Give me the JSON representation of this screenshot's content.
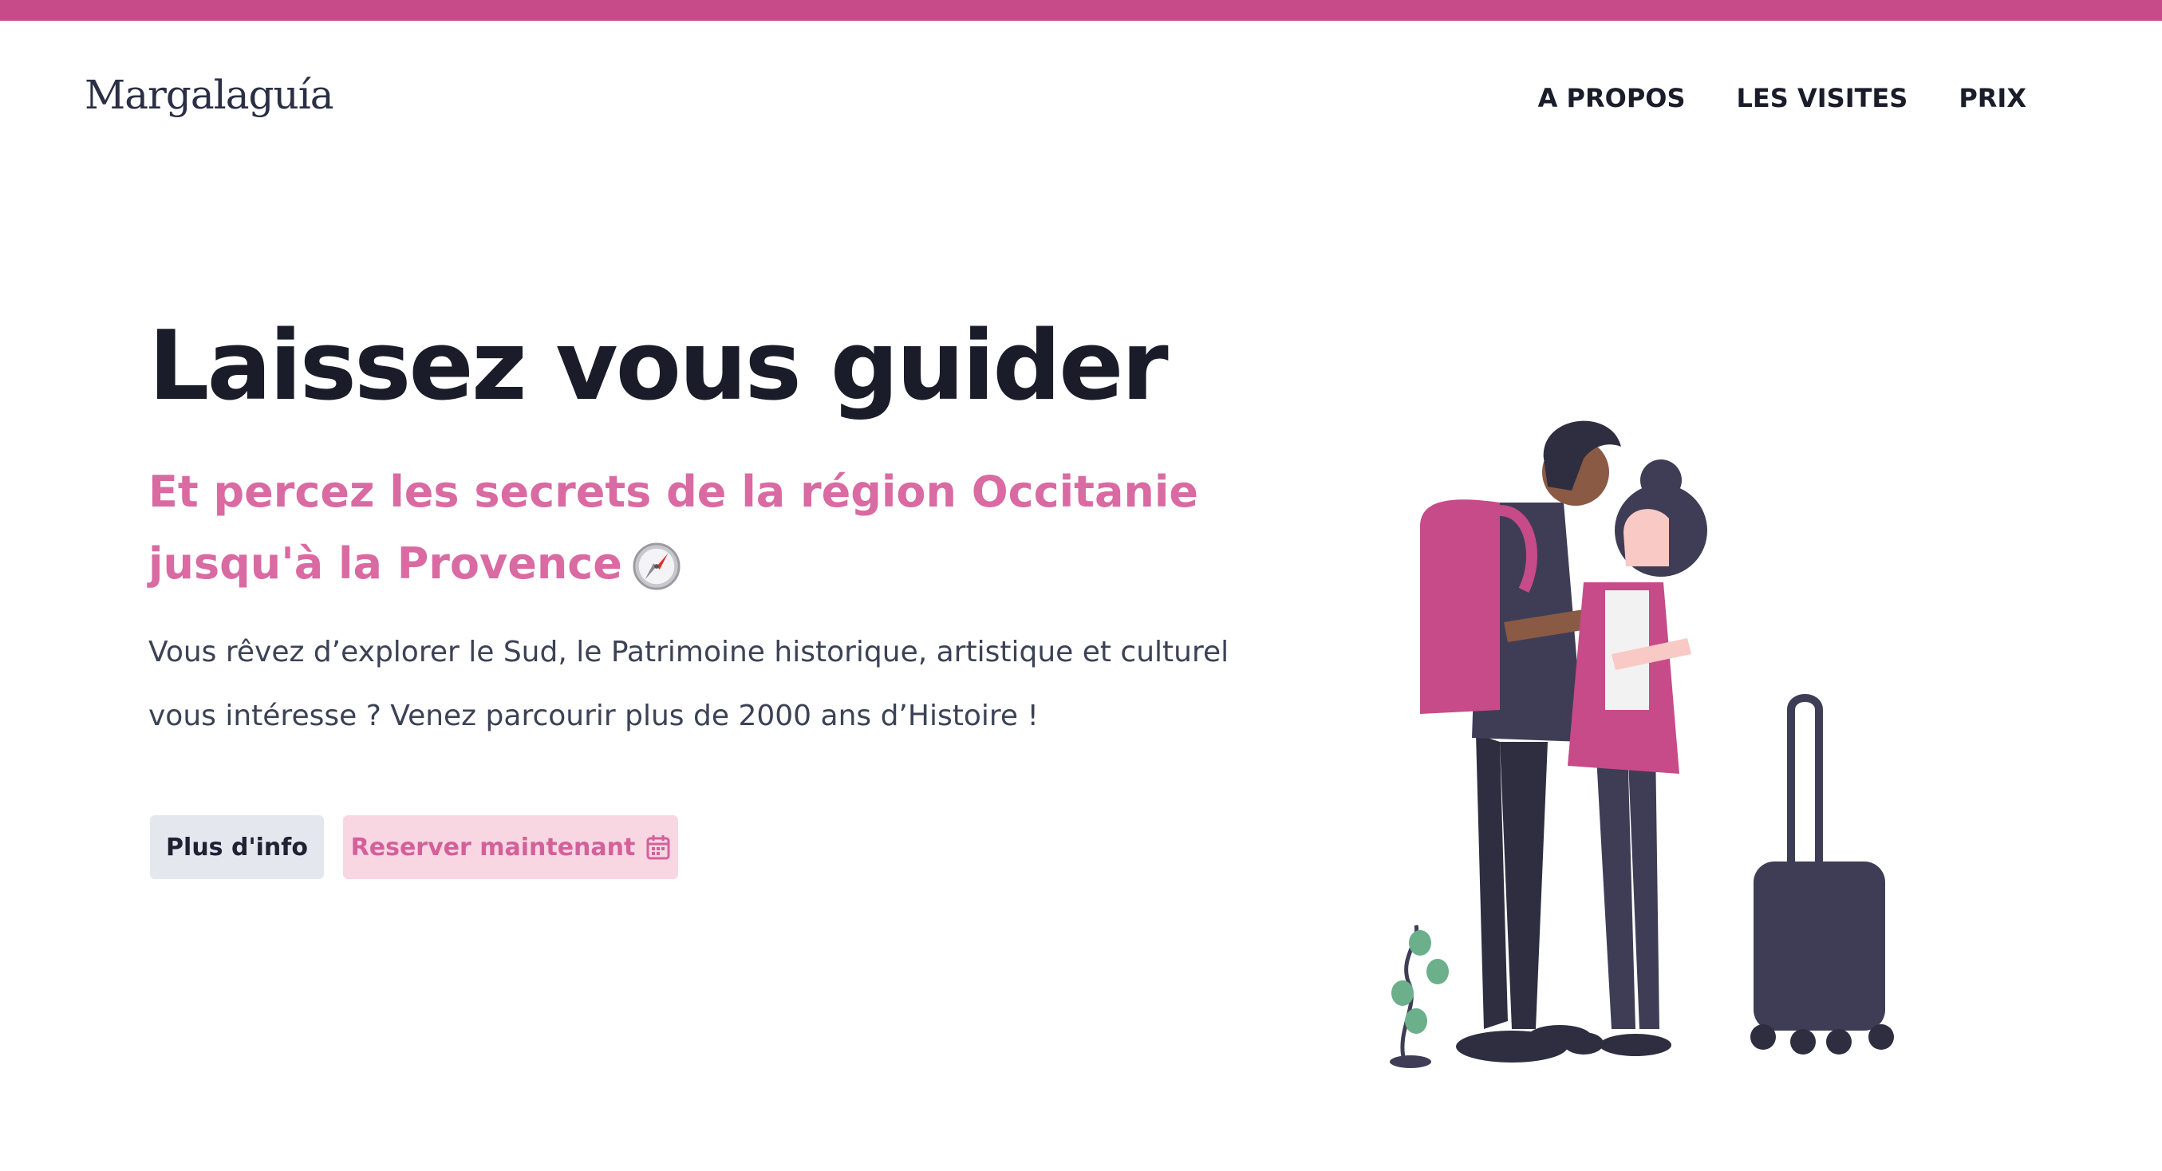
{
  "header": {
    "logo": "Margalaguía",
    "nav": [
      {
        "label": "A PROPOS"
      },
      {
        "label": "LES VISITES"
      },
      {
        "label": "PRIX"
      }
    ]
  },
  "hero": {
    "title": "Laissez vous guider",
    "subtitle": "Et percez les secrets de la région Occitanie jusqu'à la Provence",
    "subtitle_icon": "compass-icon",
    "description": "Vous rêvez d’explorer le Sud, le Patrimoine historique, artistique et culturel vous intéresse ? Venez parcourir plus de 2000 ans d’Histoire !",
    "buttons": {
      "info": "Plus d'info",
      "book": "Reserver maintenant",
      "book_icon": "calendar-icon"
    },
    "illustration": "travelers-with-suitcase-illustration"
  },
  "colors": {
    "brand": "#c64b88",
    "accent_text": "#d96aa2",
    "dark": "#1a1d29",
    "figure": "#3f3d56"
  }
}
